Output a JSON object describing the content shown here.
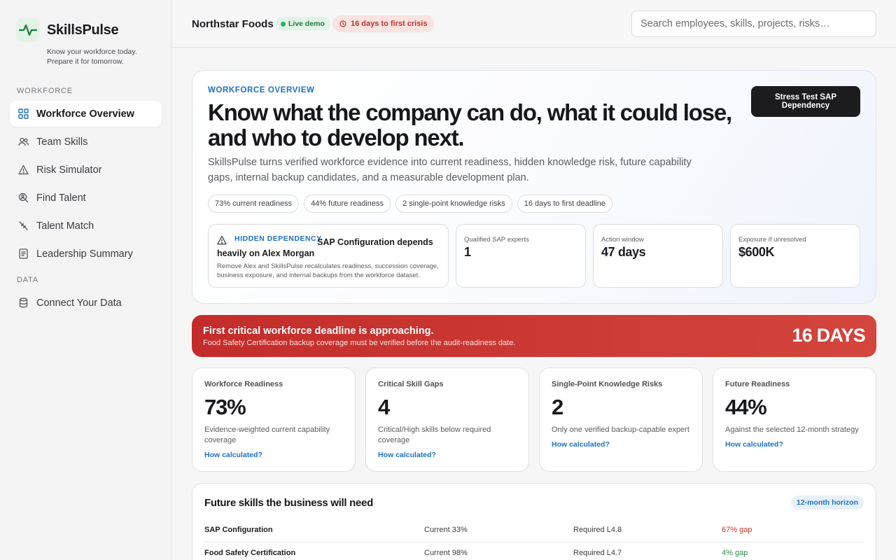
{
  "brand": {
    "name": "SkillsPulse",
    "tagline_1": "Know your workforce today.",
    "tagline_2": "Prepare it for tomorrow.",
    "logo_icon": "pulse-icon"
  },
  "sidebar": {
    "section_workforce": "WORKFORCE",
    "section_data": "DATA",
    "items": [
      {
        "label": "Workforce Overview",
        "icon": "grid-icon",
        "active": true
      },
      {
        "label": "Team Skills",
        "icon": "users-icon"
      },
      {
        "label": "Risk Simulator",
        "icon": "warning-icon"
      },
      {
        "label": "Find Talent",
        "icon": "search-person-icon"
      },
      {
        "label": "Talent Match",
        "icon": "match-arrows-icon"
      },
      {
        "label": "Leadership Summary",
        "icon": "document-icon"
      }
    ],
    "data_items": [
      {
        "label": "Connect Your Data",
        "icon": "database-icon"
      }
    ]
  },
  "topbar": {
    "company": "Northstar Foods",
    "live_badge": "Live demo",
    "crisis_badge": "16 days to first crisis",
    "search_placeholder": "Search employees, skills, projects, risks…"
  },
  "hero": {
    "eyebrow": "WORKFORCE OVERVIEW",
    "title": "Know what the company can do, what it could lose, and who to develop next.",
    "description": "SkillsPulse turns verified workforce evidence into current readiness, hidden knowledge risk, future capability gaps, internal backup candidates, and a measurable development plan.",
    "cta": "Stress Test SAP Dependency",
    "chips": [
      "73% current readiness",
      "44% future readiness",
      "2 single-point knowledge risks",
      "16 days to first deadline"
    ],
    "dependency": {
      "eyebrow": "HIDDEN DEPENDENCY",
      "title_part1": "SAP Configuration depends",
      "title_part2": "heavily on Alex Morgan",
      "description": "Remove Alex and SkillsPulse recalculates readiness, succession coverage, business exposure, and internal backups from the workforce dataset."
    },
    "stats": [
      {
        "label": "Qualified SAP experts",
        "value": "1"
      },
      {
        "label": "Action window",
        "value": "47 days"
      },
      {
        "label": "Exposure if unresolved",
        "value": "$600K"
      }
    ]
  },
  "alert": {
    "title": "First critical workforce deadline is approaching.",
    "subtitle": "Food Safety Certification backup coverage must be verified before the audit-readiness date.",
    "days": "16 DAYS"
  },
  "kpis": [
    {
      "label": "Workforce Readiness",
      "value": "73%",
      "description": "Evidence-weighted current capability coverage",
      "link": "How calculated?"
    },
    {
      "label": "Critical Skill Gaps",
      "value": "4",
      "description": "Critical/High skills below required coverage",
      "link": "How calculated?"
    },
    {
      "label": "Single-Point Knowledge Risks",
      "value": "2",
      "description": "Only one verified backup-capable expert",
      "link": "How calculated?"
    },
    {
      "label": "Future Readiness",
      "value": "44%",
      "description": "Against the selected 12-month strategy",
      "link": "How calculated?"
    }
  ],
  "future": {
    "title": "Future skills the business will need",
    "horizon": "12-month horizon",
    "rows": [
      {
        "skill": "SAP Configuration",
        "current": "Current 33%",
        "required": "Required L4.8",
        "gap": "67% gap",
        "gap_color": "#c0392b"
      },
      {
        "skill": "Food Safety Certification",
        "current": "Current 98%",
        "required": "Required L4.7",
        "gap": "4% gap",
        "gap_color": "#2e8b4e"
      }
    ]
  },
  "colors": {
    "accent": "#1d71c2",
    "danger": "#c32c2a",
    "success": "#2fb25a",
    "dark_button": "#1c1c1f"
  }
}
